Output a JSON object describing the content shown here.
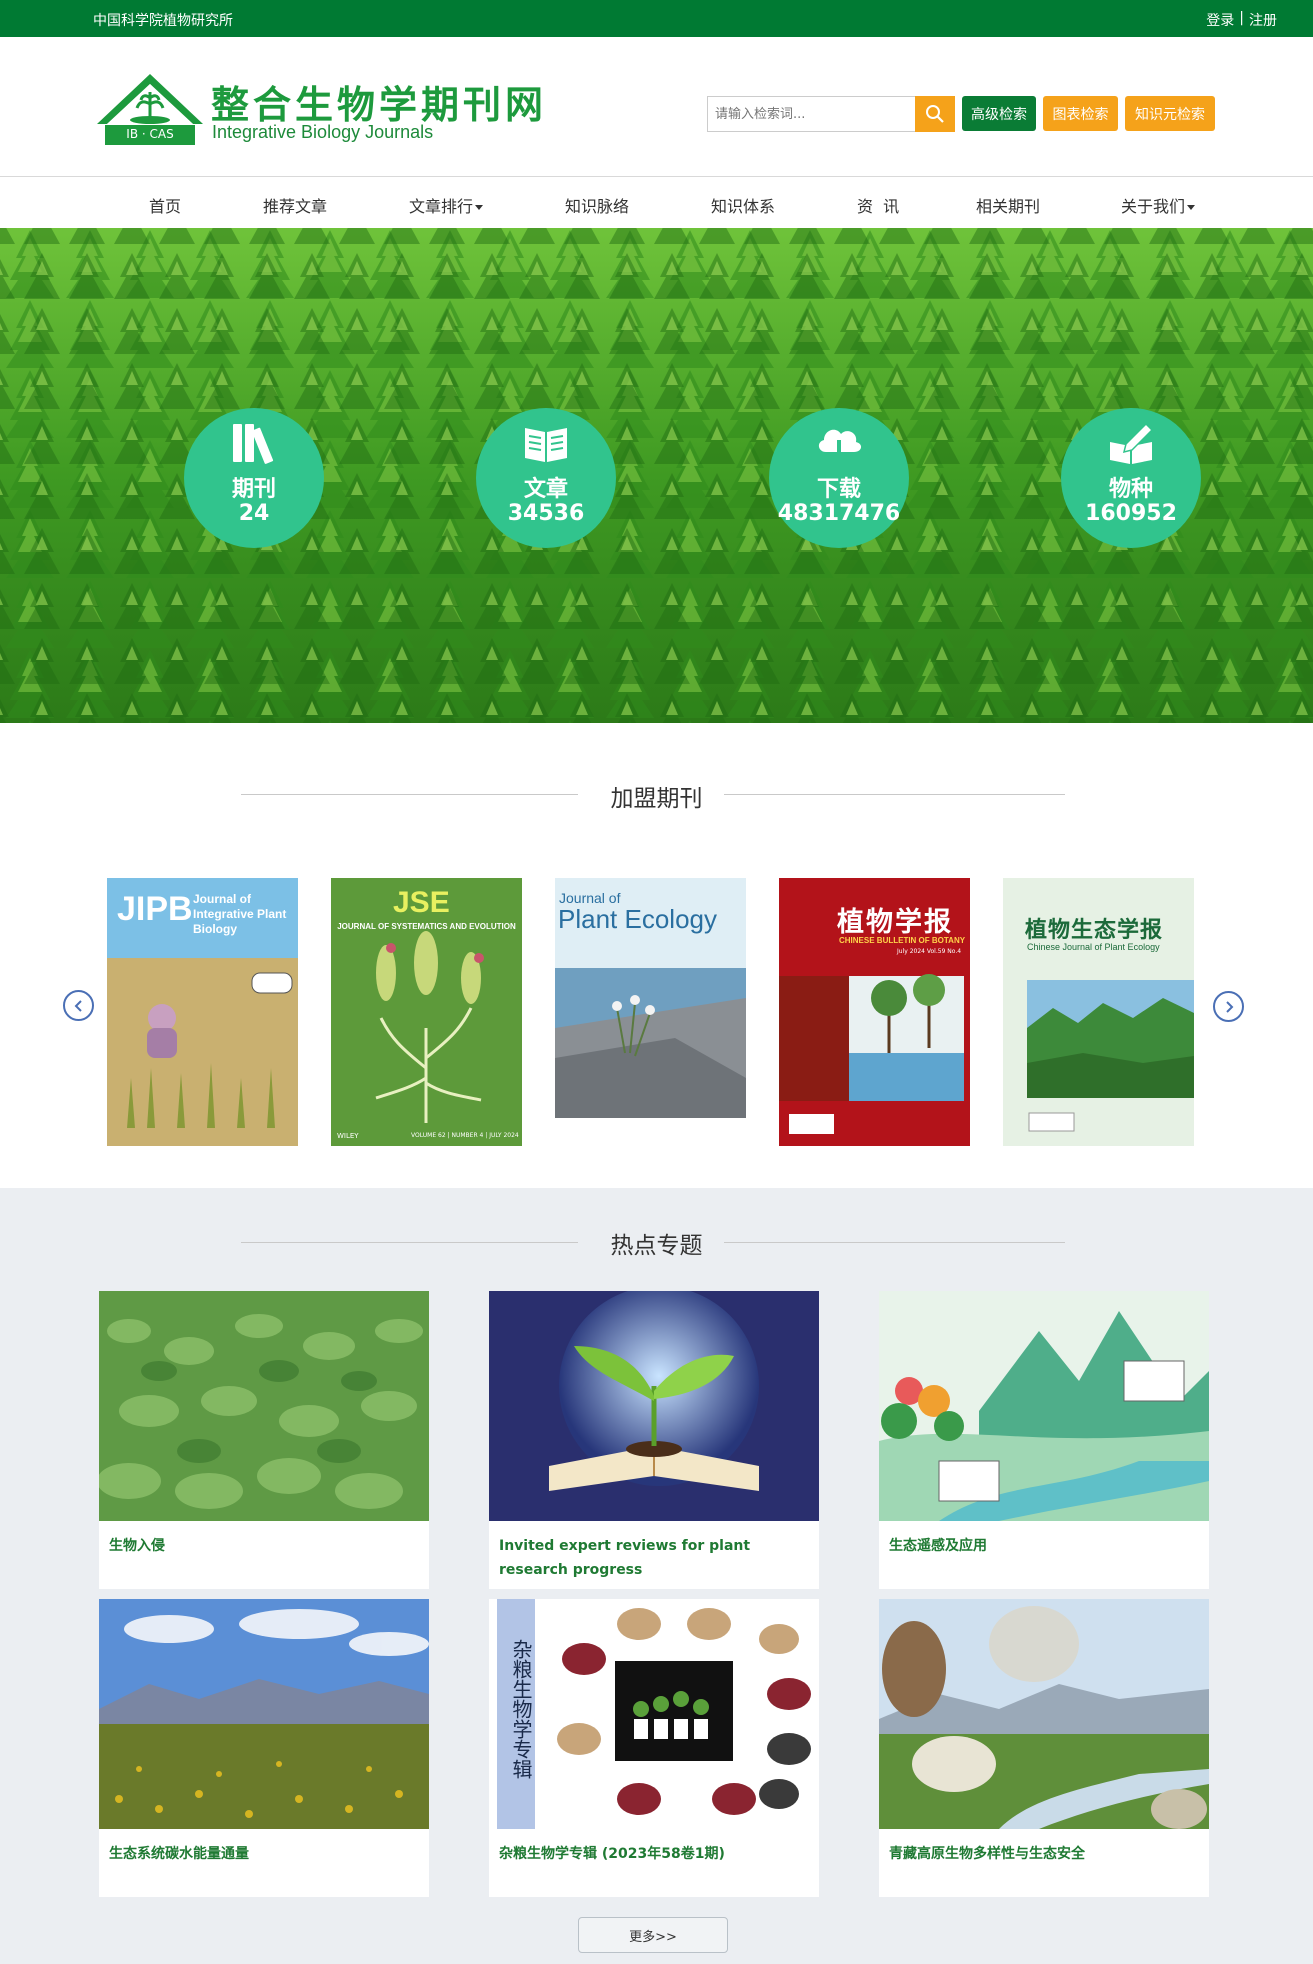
{
  "topbar": {
    "org": "中国科学院植物研究所",
    "login": "登录",
    "divider": "|",
    "register": "注册"
  },
  "logo": {
    "title_cn": "整合生物学期刊网",
    "title_en": "Integrative Biology Journals",
    "badge": "IB · CAS"
  },
  "search": {
    "placeholder": "请输入检索词..."
  },
  "header_buttons": {
    "advanced": "高级检索",
    "chart": "图表检索",
    "knowledge": "知识元检索"
  },
  "nav": {
    "items": [
      "首页",
      "推荐文章",
      "文章排行",
      "知识脉络",
      "知识体系",
      "资  讯",
      "相关期刊",
      "关于我们"
    ]
  },
  "stats": [
    {
      "label": "期刊",
      "value": "24",
      "icon": "books-icon"
    },
    {
      "label": "文章",
      "value": "34536",
      "icon": "open-book-icon"
    },
    {
      "label": "下载",
      "value": "48317476",
      "icon": "cloud-download-icon"
    },
    {
      "label": "物种",
      "value": "160952",
      "icon": "book-pen-icon"
    }
  ],
  "journals_section": {
    "title": "加盟期刊"
  },
  "journals": [
    {
      "abbr": "JIPB",
      "name": "Journal of Integrative Plant Biology"
    },
    {
      "abbr": "JSE",
      "name": "JOURNAL OF SYSTEMATICS AND EVOLUTION",
      "footer": "VOLUME 62 | NUMBER 4 | JULY 2024",
      "publisher": "WILEY"
    },
    {
      "name_small": "Journal of",
      "name": "Plant Ecology"
    },
    {
      "name": "植物学报",
      "name_en": "CHINESE BULLETIN OF BOTANY",
      "issue": "July 2024  Vol.59  No.4"
    },
    {
      "name": "植物生态学报",
      "name_en": "Chinese Journal of Plant Ecology"
    }
  ],
  "topics_section": {
    "title": "热点专题"
  },
  "topics": [
    "生物入侵",
    "Invited expert reviews for plant research progress",
    "生态遥感及应用",
    "生态系统碳水能量通量",
    "杂粮生物学专辑 (2023年58卷1期)",
    "青藏高原生物多样性与生态安全"
  ],
  "topic_vertical_label": "杂粮生物学专辑",
  "more_button": "更多>>",
  "colors": {
    "brand_green": "#007a33",
    "accent_orange": "#f5a21a",
    "stat_circle": "#31c48d",
    "topic_caption": "#1f7a33"
  }
}
